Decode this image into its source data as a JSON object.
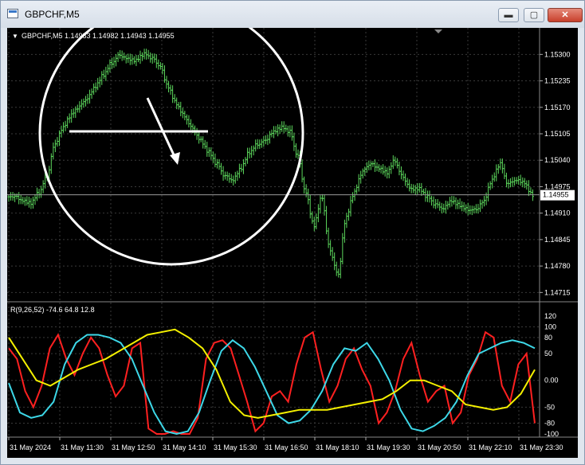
{
  "window": {
    "title": "GBPCHF,M5",
    "minimize": "▬",
    "maximize": "▢",
    "close": "✕"
  },
  "colors": {
    "candle": "#5cd65c",
    "line_red": "#ff2020",
    "line_cyan": "#3dd8e8",
    "line_yellow": "#f4f000",
    "grid": "#3a3a3a",
    "text": "#ffffff"
  },
  "price_header": {
    "arrow": "▼",
    "text": "GBPCHF,M5  1.14983 1.14982 1.14943 1.14955"
  },
  "indicator_header": {
    "text": "R(9,26,52) -74.6 64.8 12.8"
  },
  "price_axis": {
    "labels": [
      "1.15300",
      "1.15235",
      "1.15170",
      "1.15105",
      "1.15040",
      "1.14975",
      "1.14910",
      "1.14845",
      "1.14780",
      "1.14715"
    ],
    "current": "1.14955"
  },
  "indicator_axis": {
    "labels": [
      "120",
      "100",
      "80",
      "50",
      "0.00",
      "-50",
      "-80",
      "-100"
    ]
  },
  "time_axis": {
    "labels": [
      "31 May 2024",
      "31 May 11:30",
      "31 May 12:50",
      "31 May 14:10",
      "31 May 15:30",
      "31 May 16:50",
      "31 May 18:10",
      "31 May 19:30",
      "31 May 20:50",
      "31 May 22:10",
      "31 May 23:30"
    ]
  },
  "chart_data": {
    "type": "line",
    "price": {
      "ylim": [
        1.147,
        1.1533
      ],
      "close": [
        1.1495,
        1.1494,
        1.14935,
        1.1496,
        1.15,
        1.1508,
        1.1512,
        1.1515,
        1.1517,
        1.1519,
        1.1522,
        1.1525,
        1.1528,
        1.153,
        1.1529,
        1.15285,
        1.153,
        1.1529,
        1.1527,
        1.1522,
        1.1518,
        1.1515,
        1.1512,
        1.1509,
        1.1506,
        1.1503,
        1.15,
        1.1499,
        1.1502,
        1.1506,
        1.1508,
        1.1509,
        1.1511,
        1.1512,
        1.1511,
        1.1505,
        1.1496,
        1.1488,
        1.1495,
        1.1482,
        1.1476,
        1.149,
        1.1496,
        1.1501,
        1.1503,
        1.1502,
        1.1501,
        1.1504,
        1.15,
        1.1497,
        1.1497,
        1.1495,
        1.1493,
        1.1492,
        1.1494,
        1.1493,
        1.1492,
        1.1492,
        1.1494,
        1.1499,
        1.1503,
        1.1498,
        1.1499,
        1.14985,
        1.14955
      ]
    },
    "indicator": {
      "ylim": [
        -100,
        120
      ],
      "series": [
        {
          "values": [
            60,
            40,
            -20,
            -50,
            -10,
            60,
            85,
            40,
            10,
            50,
            80,
            60,
            10,
            -30,
            -10,
            60,
            70,
            -90,
            -100,
            -100,
            -95,
            -100,
            -100,
            -70,
            40,
            70,
            75,
            60,
            10,
            -40,
            -95,
            -80,
            -30,
            -20,
            -40,
            30,
            80,
            90,
            20,
            -40,
            -10,
            40,
            60,
            20,
            -10,
            -80,
            -60,
            -20,
            40,
            70,
            10,
            -40,
            -20,
            -10,
            -80,
            -60,
            10,
            40,
            90,
            80,
            -10,
            -40,
            30,
            50,
            -80
          ]
        },
        {
          "values": [
            -5,
            -60,
            -70,
            -65,
            -40,
            30,
            70,
            85,
            85,
            80,
            70,
            40,
            -10,
            -60,
            -95,
            -100,
            -95,
            -60,
            0,
            55,
            75,
            60,
            25,
            -20,
            -65,
            -80,
            -75,
            -55,
            -20,
            30,
            60,
            55,
            70,
            40,
            0,
            -55,
            -90,
            -95,
            -85,
            -70,
            -40,
            10,
            50,
            60,
            70,
            75,
            70,
            60
          ]
        },
        {
          "values": [
            80,
            40,
            0,
            -10,
            5,
            20,
            30,
            40,
            55,
            70,
            85,
            90,
            95,
            80,
            60,
            20,
            -40,
            -65,
            -70,
            -65,
            -60,
            -55,
            -55,
            -55,
            -50,
            -45,
            -40,
            -35,
            -20,
            0,
            0,
            -10,
            -20,
            -45,
            -50,
            -55,
            -50,
            -25,
            20
          ]
        }
      ]
    }
  }
}
